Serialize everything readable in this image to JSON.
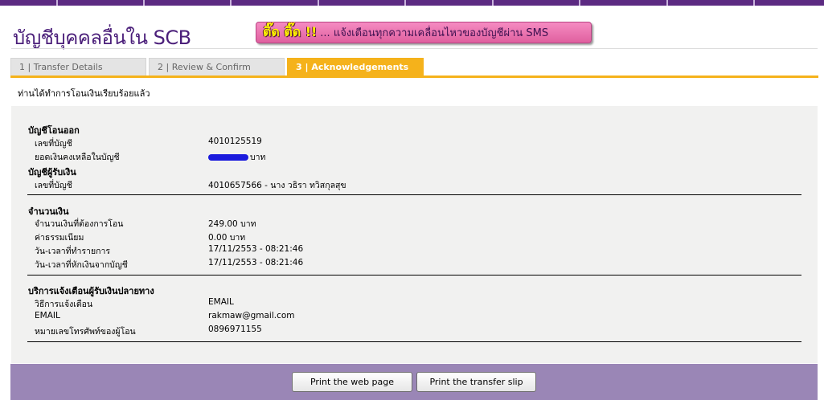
{
  "page": {
    "title": "บัญชีบุคคลอื่นใน SCB",
    "success_message": "ท่านได้ทำการโอนเงินเรียบร้อยแล้ว"
  },
  "sms_banner": {
    "highlight": "ติ๊ด ติ๊ด !!",
    "message": "... แจ้งเตือนทุกความเคลื่อนไหวของบัญชีผ่าน SMS"
  },
  "tabs": [
    {
      "label": "1 | Transfer Details",
      "active": false
    },
    {
      "label": "2 | Review & Confirm",
      "active": false
    },
    {
      "label": "3 | Acknowledgements",
      "active": true
    }
  ],
  "from_account": {
    "heading": "บัญชีโอนออก",
    "account_no_label": "เลขที่บัญชี",
    "account_no": "4010125519",
    "balance_label": "ยอดเงินคงเหลือในบัญชี",
    "balance_unit": "บาท"
  },
  "to_account": {
    "heading": "บัญชีผู้รับเงิน",
    "account_no_label": "เลขที่บัญชี",
    "account_no": "4010657566 - นาง วธิรา ทวิสกุลสุข"
  },
  "amount": {
    "heading": "จำนวนเงิน",
    "rows": [
      {
        "label": "จำนวนเงินที่ต้องการโอน",
        "value": "249.00 บาท"
      },
      {
        "label": "ค่าธรรมเนียม",
        "value": "0.00 บาท"
      },
      {
        "label": "วัน-เวลาที่ทำรายการ",
        "value": "17/11/2553 - 08:21:46"
      },
      {
        "label": "วัน-เวลาที่หักเงินจากบัญชี",
        "value": "17/11/2553 - 08:21:46"
      }
    ]
  },
  "notify": {
    "heading": "บริการแจ้งเตือนผู้รับเงินปลายทาง",
    "rows": [
      {
        "label": "วิธีการแจ้งเตือน",
        "value": "EMAIL"
      },
      {
        "label": "EMAIL",
        "value": "rakmaw@gmail.com"
      },
      {
        "label": "หมายเลขโทรศัพท์ของผู้โอน",
        "value": "0896971155"
      }
    ]
  },
  "buttons": {
    "print_page": "Print the web page",
    "print_slip": "Print the transfer slip"
  },
  "colors": {
    "brand_purple": "#5c2a82",
    "tab_active": "#f5b21b",
    "footer": "#9a86b6",
    "redaction": "#1b1bdd"
  }
}
